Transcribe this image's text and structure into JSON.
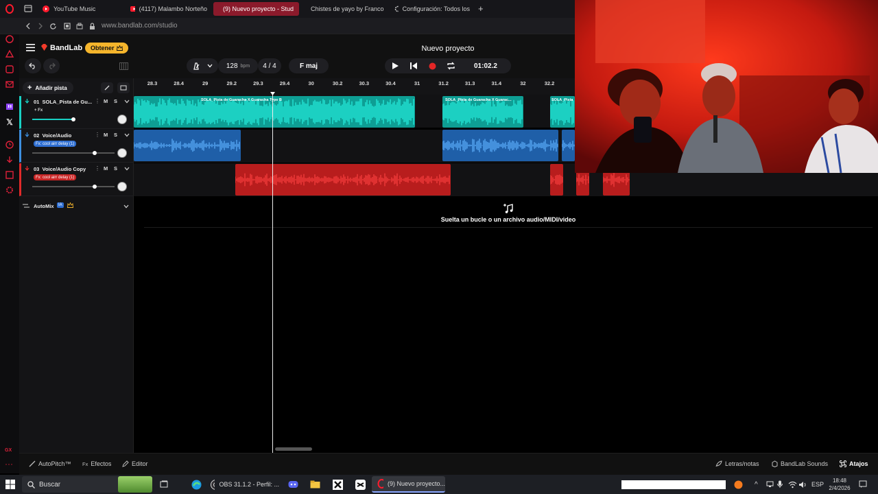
{
  "browser": {
    "tabs": [
      {
        "label": "YouTube Music",
        "active": false
      },
      {
        "label": "(4117) Malambo Norteño",
        "active": false
      },
      {
        "label": "(9) Nuevo proyecto - Stud",
        "active": true
      },
      {
        "label": "Chistes de yayo by Franco",
        "active": false
      },
      {
        "label": "Configuración: Todos los",
        "active": false
      }
    ],
    "url": "www.bandlab.com/studio"
  },
  "app": {
    "brand": "BandLab",
    "obtener": "Obtener",
    "project_title": "Nuevo proyecto",
    "add_track": "Añadir pista",
    "automix": "AutoMix",
    "automix_badge": "IA",
    "drop_hint": "Suelta un bucle o un archivo audio/MIDI/video"
  },
  "transport": {
    "tempo": "128",
    "tempo_unit": "bpm",
    "time_signature": "4 / 4",
    "key": "F maj",
    "time": "01:02.2"
  },
  "ruler": [
    "28.3",
    "28.4",
    "29",
    "29.2",
    "29.3",
    "29.4",
    "30",
    "30.2",
    "30.3",
    "30.4",
    "31",
    "31.2",
    "31.3",
    "31.4",
    "32",
    "32.2"
  ],
  "tracks": [
    {
      "number": "01",
      "name": "SOLA_Pista de Gu...",
      "fx": "+ Fx",
      "color": "#19d1c4",
      "volume": 0.7
    },
    {
      "number": "02",
      "name": "Voice/Audio",
      "fx": "Fx: cool airr delay (1)",
      "color": "#3d8fe0",
      "volume": 0.92
    },
    {
      "number": "03",
      "name": "Voice/Audio Copy",
      "fx": "Fx: cool airr delay (1)",
      "color": "#e02a2a",
      "volume": 0.92
    }
  ],
  "regions": {
    "track1": [
      "SOLA_Pista de Guaracha X Guaracha Type B",
      "SOLA_Pista de Guaracha X Guarac...",
      "SOLA_Pista"
    ]
  },
  "bottom": {
    "autopitch": "AutoPitch™",
    "efectos": "Efectos",
    "editor": "Editor",
    "letras": "Letras/notas",
    "sounds": "BandLab Sounds",
    "atajos": "Atajos"
  },
  "taskbar": {
    "search": "Buscar",
    "obs": "OBS 31.1.2 - Perfil: ...",
    "browser_item": "(9) Nuevo proyecto...",
    "lang": "ESP",
    "time": "18:48",
    "date": "2/4/2026"
  }
}
